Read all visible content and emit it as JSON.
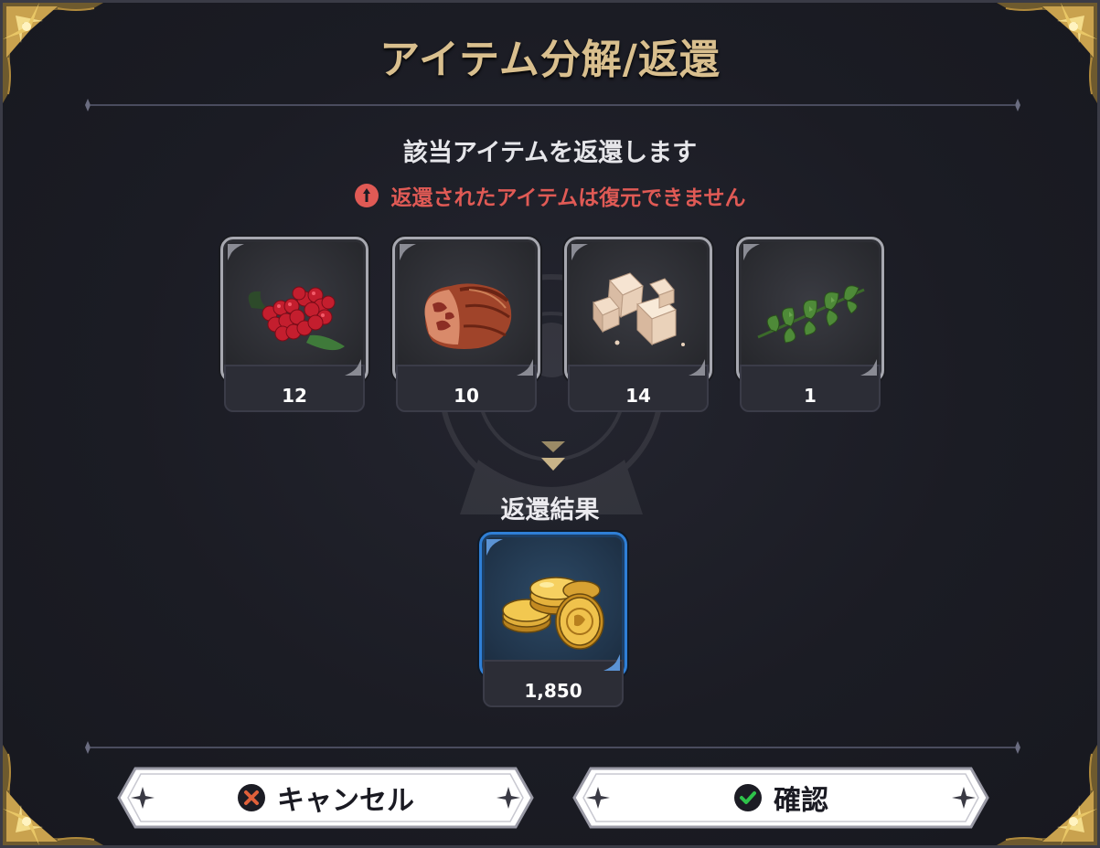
{
  "dialog": {
    "title": "アイテム分解/返還",
    "subtitle": "該当アイテムを返還します",
    "warning": "返還されたアイテムは復元できません"
  },
  "items": [
    {
      "icon": "raspberry-icon",
      "count": "12"
    },
    {
      "icon": "meat-icon",
      "count": "10"
    },
    {
      "icon": "tofu-cubes-icon",
      "count": "14"
    },
    {
      "icon": "herb-icon",
      "count": "1"
    }
  ],
  "result": {
    "label": "返還結果",
    "icon": "gold-coins-icon",
    "count": "1,850"
  },
  "buttons": {
    "cancel_label": "キャンセル",
    "confirm_label": "確認"
  },
  "colors": {
    "title_gold": "#d9bf8e",
    "warning_red": "#e05a55",
    "result_blue": "#2f7fd6",
    "cancel_icon_orange": "#e0603a",
    "confirm_icon_green": "#2ec24a"
  }
}
